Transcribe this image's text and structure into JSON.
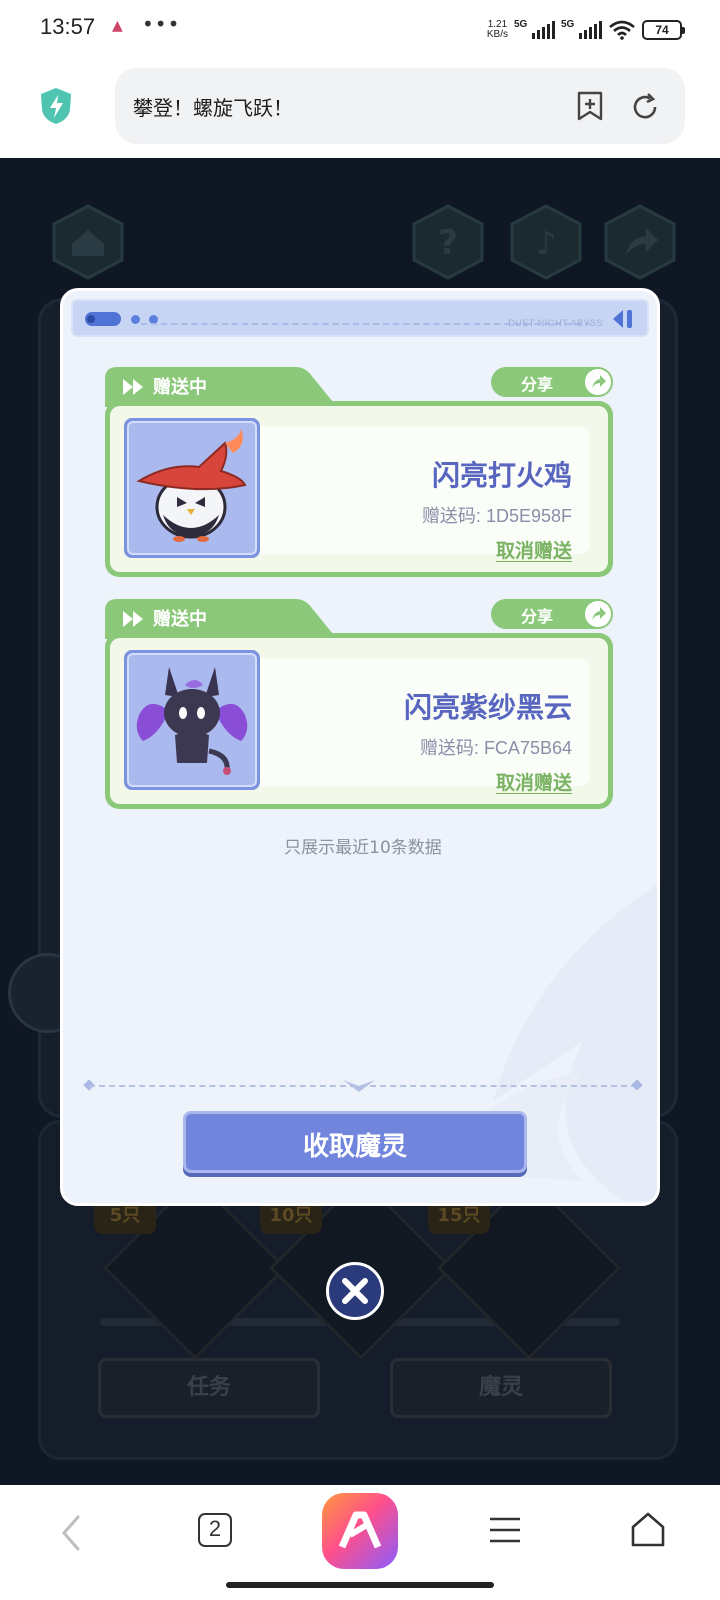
{
  "status_bar": {
    "time": "13:57",
    "more": "•••",
    "net_speed_value": "1.21",
    "net_speed_unit": "KB/s",
    "sim1_label": "5G",
    "sim2_label": "5G",
    "battery": "74"
  },
  "browser": {
    "page_title": "攀登！螺旋飞跃！",
    "tab_count": "2"
  },
  "background": {
    "milestones": [
      "5只",
      "10只",
      "15只"
    ],
    "tabs": [
      "任务",
      "魔灵"
    ]
  },
  "modal": {
    "brand": "DUET NIGHT ABYSS",
    "share_label": "分享",
    "status_label": "赠送中",
    "cards": [
      {
        "status": "赠送中",
        "share": "分享",
        "name": "闪亮打火鸡",
        "code": "赠送码: 1D5E958F",
        "cancel": "取消赠送"
      },
      {
        "status": "赠送中",
        "share": "分享",
        "name": "闪亮紫纱黑云",
        "code": "赠送码: FCA75B64",
        "cancel": "取消赠送"
      }
    ],
    "footnote": "只展示最近10条数据",
    "collect_button": "收取魔灵"
  },
  "colors": {
    "card_green": "#8bc87a",
    "button_blue": "#7185dc",
    "name_blue": "#5866c0",
    "link_green": "#7ab363"
  }
}
